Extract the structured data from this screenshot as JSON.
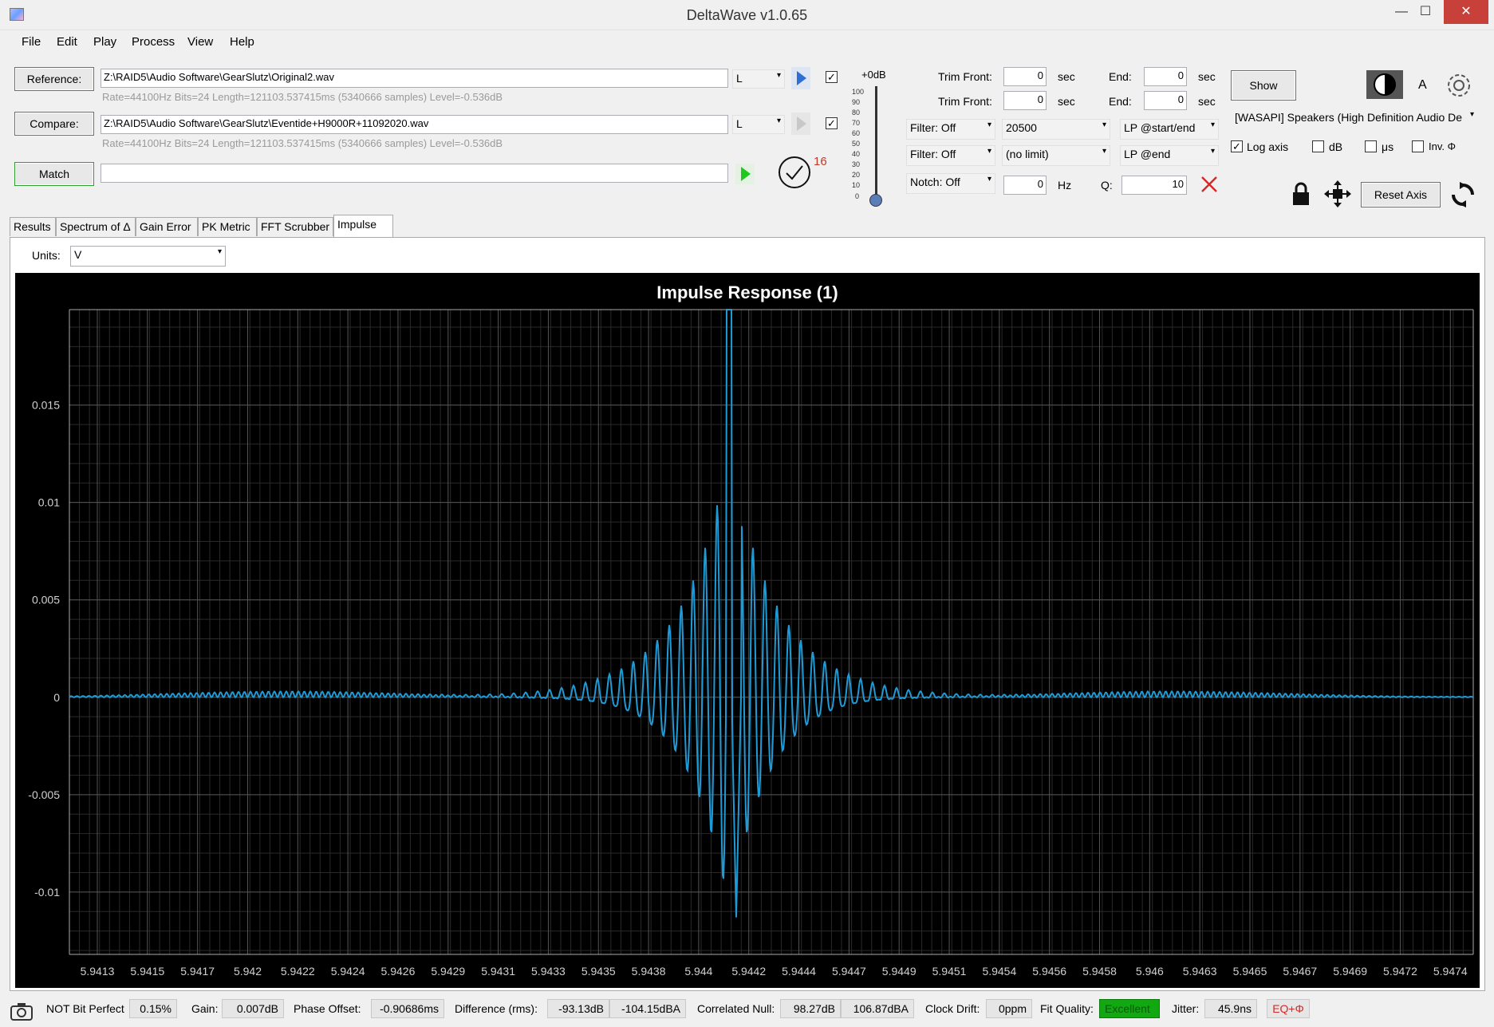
{
  "window": {
    "title": "DeltaWave v1.0.65",
    "minimize": "—",
    "maximize": "☐",
    "close": "✕"
  },
  "menu": [
    "File",
    "Edit",
    "Play",
    "Process",
    "View",
    "Help"
  ],
  "reference": {
    "button": "Reference:",
    "path": "Z:\\RAID5\\Audio Software\\GearSlutz\\Original2.wav",
    "info": "Rate=44100Hz Bits=24 Length=121103.537415ms (5340666 samples) Level=-0.536dB",
    "channel": "L"
  },
  "compare": {
    "button": "Compare:",
    "path": "Z:\\RAID5\\Audio Software\\GearSlutz\\Eventide+H9000R+11092020.wav",
    "info": "Rate=44100Hz Bits=24 Length=121103.537415ms (5340666 samples) Level=-0.536dB",
    "channel": "L"
  },
  "match": {
    "button": "Match",
    "progress": "",
    "count": "16"
  },
  "volume": {
    "label": "+0dB",
    "ticks": [
      "100",
      "90",
      "80",
      "70",
      "60",
      "50",
      "40",
      "30",
      "20",
      "10",
      "0"
    ]
  },
  "trim": [
    {
      "front_label": "Trim Front:",
      "front": "0",
      "unit1": "sec",
      "end_label": "End:",
      "end": "0",
      "unit2": "sec"
    },
    {
      "front_label": "Trim Front:",
      "front": "0",
      "unit1": "sec",
      "end_label": "End:",
      "end": "0",
      "unit2": "sec"
    }
  ],
  "filters": [
    {
      "mode": "Filter: Off",
      "value": "20500",
      "type": "LP @start/end"
    },
    {
      "mode": "Filter: Off",
      "value": "(no limit)",
      "type": "LP @end"
    }
  ],
  "notch": {
    "mode": "Notch: Off",
    "hz": "0",
    "hz_label": "Hz",
    "q_label": "Q:",
    "q": "10"
  },
  "right_panel": {
    "show": "Show",
    "a_label": "A",
    "device": "[WASAPI] Speakers (High Definition Audio De",
    "log_axis": "Log axis",
    "db": "dB",
    "us": "μs",
    "inv": "Inv. Φ",
    "reset_axis": "Reset Axis"
  },
  "tabs": [
    "Results",
    "Spectrum of Δ",
    "Gain Error",
    "PK Metric",
    "FFT Scrubber",
    "Impulse"
  ],
  "units": {
    "label": "Units:",
    "value": "V"
  },
  "chart_data": {
    "type": "line",
    "title": "Impulse Response (1)",
    "ylim": [
      -0.0132,
      0.0199
    ],
    "yticks": [
      "0.015",
      "0.01",
      "0.005",
      "0",
      "-0.005",
      "-0.01"
    ],
    "ytick_values": [
      0.015,
      0.01,
      0.005,
      0,
      -0.005,
      -0.01
    ],
    "xticks": [
      "5.9413",
      "5.9415",
      "5.9417",
      "5.942",
      "5.9422",
      "5.9424",
      "5.9426",
      "5.9429",
      "5.9431",
      "5.9433",
      "5.9435",
      "5.9438",
      "5.944",
      "5.9442",
      "5.9444",
      "5.9447",
      "5.9449",
      "5.9451",
      "5.9454",
      "5.9456",
      "5.9458",
      "5.946",
      "5.9463",
      "5.9465",
      "5.9467",
      "5.9469",
      "5.9472",
      "5.9474"
    ],
    "grid": true,
    "color": "#1e9bd7",
    "peak": {
      "x": 5.94428,
      "y": 0.0199,
      "min": -0.0113
    }
  },
  "status": {
    "bit_perfect": "NOT Bit Perfect",
    "bit_perfect_val": "0.15%",
    "gain_label": "Gain:",
    "gain": "0.007dB",
    "phase_label": "Phase Offset:",
    "phase": "-0.90686ms",
    "diff_label": "Difference (rms):",
    "diff1": "-93.13dB",
    "diff2": "-104.15dBA",
    "null_label": "Correlated Null:",
    "null1": "98.27dB",
    "null2": "106.87dBA",
    "drift_label": "Clock Drift:",
    "drift": "0ppm",
    "fit_label": "Fit Quality:",
    "fit": "Excellent",
    "jitter_label": "Jitter:",
    "jitter": "45.9ns",
    "eq": "EQ+Φ"
  }
}
